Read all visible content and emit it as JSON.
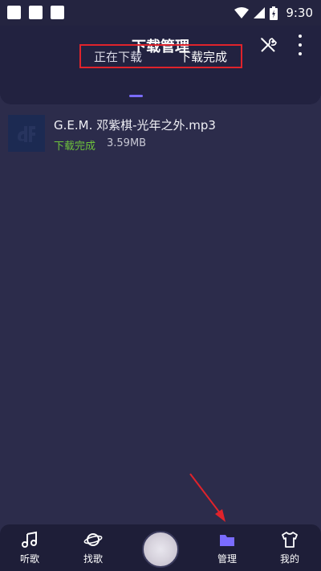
{
  "status_bar": {
    "time": "9:30"
  },
  "header": {
    "title": "下载管理",
    "tabs": [
      {
        "label": "正在下载"
      },
      {
        "label": "下载完成"
      }
    ]
  },
  "downloads": [
    {
      "name": "G.E.M. 邓紫棋-光年之外.mp3",
      "status": "下载完成",
      "size": "3.59MB"
    }
  ],
  "bottom_nav": [
    {
      "label": "听歌"
    },
    {
      "label": "找歌"
    },
    {
      "label": "管理"
    },
    {
      "label": "我的"
    }
  ],
  "colors": {
    "accent": "#7a6cff",
    "status_done": "#6ec23c",
    "highlight_box": "#e0232b",
    "background": "#2c2c4b"
  }
}
